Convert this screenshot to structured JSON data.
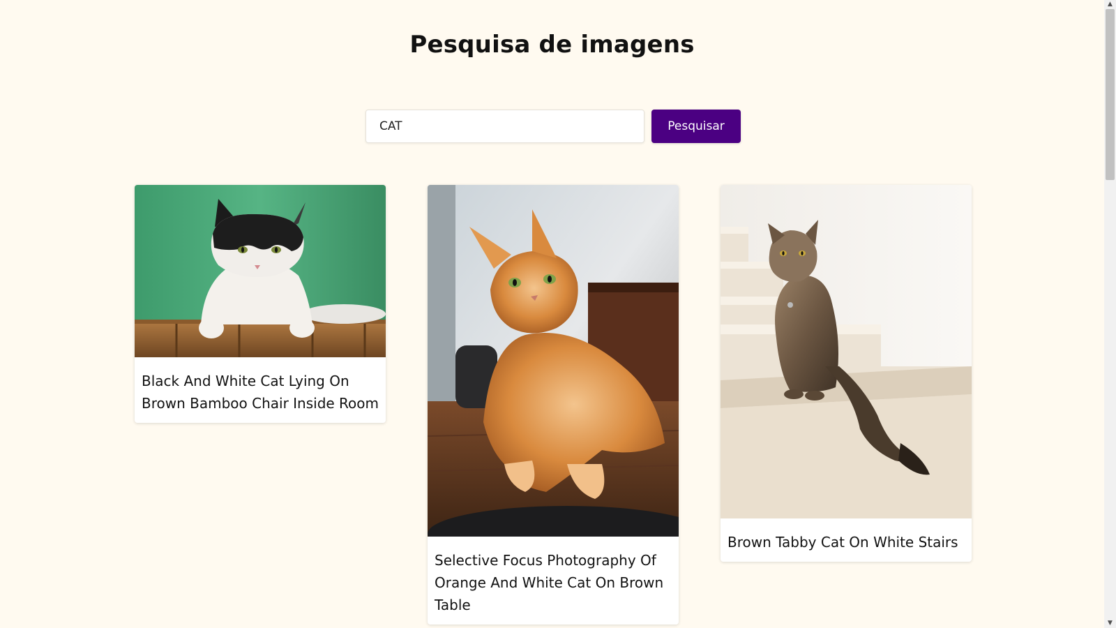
{
  "header": {
    "title": "Pesquisa de imagens"
  },
  "search": {
    "value": "CAT",
    "button_label": "Pesquisar"
  },
  "results": [
    {
      "caption": "Black And White Cat Lying On Brown Bamboo Chair Inside Room",
      "image_description": "black and white cat on bamboo chair, green wall"
    },
    {
      "caption": "Selective Focus Photography Of Orange And White Cat On Brown Table",
      "image_description": "orange cat on wooden table"
    },
    {
      "caption": "Brown Tabby Cat On White Stairs",
      "image_description": "tabby cat on white stairs"
    }
  ],
  "colors": {
    "page_background": "#fffaf0",
    "button_background": "#4b0082",
    "button_text": "#ffffff"
  },
  "icons": {
    "scroll_up": "chevron-up-icon",
    "scroll_down": "chevron-down-icon"
  }
}
